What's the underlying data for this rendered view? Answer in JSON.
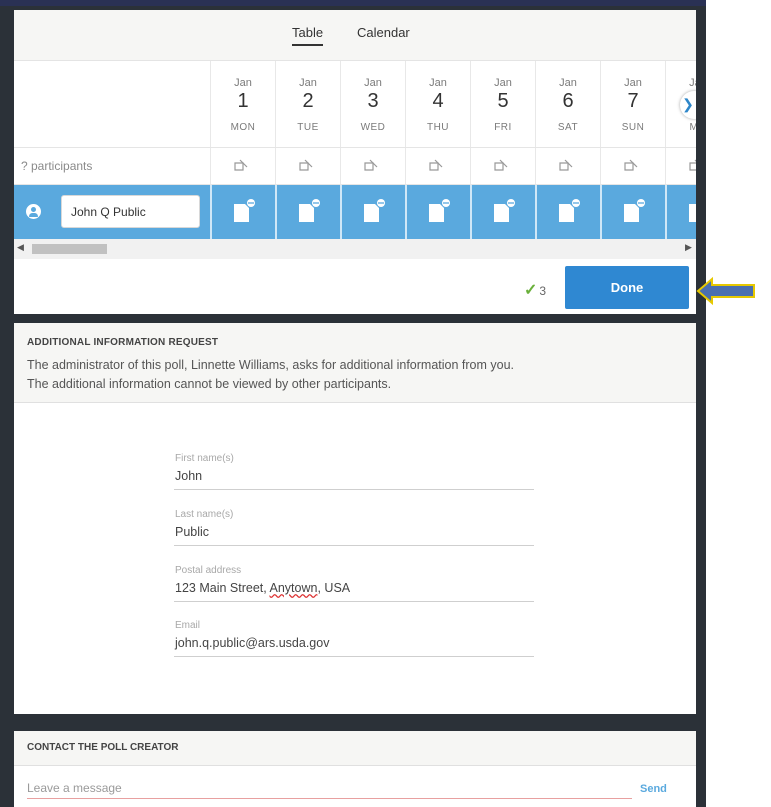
{
  "view_tabs": [
    {
      "label": "Table",
      "active": true
    },
    {
      "label": "Calendar",
      "active": false
    }
  ],
  "dates": [
    {
      "month": "Jan",
      "day": "1",
      "weekday": "MON"
    },
    {
      "month": "Jan",
      "day": "2",
      "weekday": "TUE"
    },
    {
      "month": "Jan",
      "day": "3",
      "weekday": "WED"
    },
    {
      "month": "Jan",
      "day": "4",
      "weekday": "THU"
    },
    {
      "month": "Jan",
      "day": "5",
      "weekday": "FRI"
    },
    {
      "month": "Jan",
      "day": "6",
      "weekday": "SAT"
    },
    {
      "month": "Jan",
      "day": "7",
      "weekday": "SUN"
    },
    {
      "month": "Jan",
      "day": "",
      "weekday": "MO"
    }
  ],
  "participants": {
    "count_label": "? participants",
    "tally_icon": "muted-vote-icon"
  },
  "entry": {
    "user_icon": "user-icon",
    "name_value": "John Q Public",
    "vote_icon": "vote-note-icon"
  },
  "next_icon": "chevron-right-icon",
  "summary": {
    "yes_count": "3",
    "check_icon": "check-icon",
    "done_label": "Done"
  },
  "info": {
    "title": "ADDITIONAL INFORMATION REQUEST",
    "text_1": "The administrator of this poll, Linnette Williams, asks for additional information from you.",
    "text_2": "The additional information cannot be viewed by other participants.",
    "fields": {
      "first_name": {
        "label": "First name(s)",
        "value": "John"
      },
      "last_name": {
        "label": "Last name(s)",
        "value": "Public"
      },
      "postal": {
        "label": "Postal address",
        "value_pre": "123 Main Street, ",
        "value_mid": "Anytown",
        "value_post": ", USA"
      },
      "email": {
        "label": "Email",
        "value": "john.q.public@ars.usda.gov"
      }
    }
  },
  "contact": {
    "title": "CONTACT THE POLL CREATOR",
    "placeholder": "Leave a message",
    "send_label": "Send"
  },
  "colors": {
    "accent_blue": "#2f88d2",
    "row_blue": "#5aa9de",
    "check_green": "#6ab03b",
    "arrow_fill": "#4a6fb0",
    "arrow_outline": "#e6c800",
    "frame_dark": "#2b3138"
  }
}
